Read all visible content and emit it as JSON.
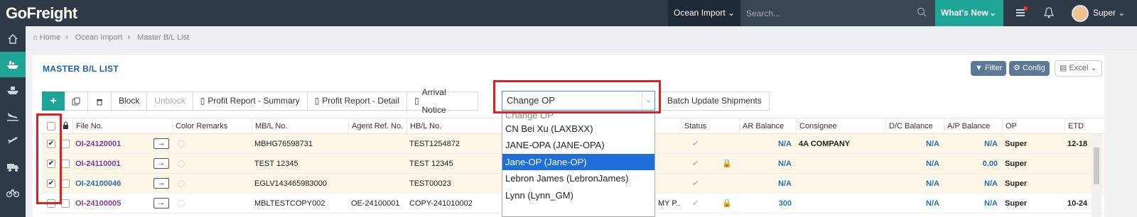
{
  "app": {
    "logo": "GoFreight"
  },
  "topbar": {
    "module": "Ocean Import",
    "search_placeholder": "Search...",
    "whats_new": "What's New",
    "user": "Super"
  },
  "breadcrumb": [
    "Home",
    "Ocean Import",
    "Master B/L List"
  ],
  "page": {
    "title": "MASTER B/L LIST",
    "filter": "Filter",
    "config": "Config",
    "excel": "Excel"
  },
  "toolbar": {
    "block": "Block",
    "unblock": "Unblock",
    "profit_summary": "Profit Report - Summary",
    "profit_detail": "Profit Report - Detail",
    "arrival_notice": "Arrival Notice",
    "change_op_value": "Change OP",
    "batch_update": "Batch Update Shipments"
  },
  "dropdown": {
    "options": [
      "Change OP",
      "CN Bei Xu (LAXBXX)",
      "JANE-OPA (JANE-OPA)",
      "Jane-OP (Jane-OP)",
      "Lebron James (LebronJames)",
      "Lynn (Lynn_GM)"
    ],
    "highlighted": "Jane-OP (Jane-OP)"
  },
  "columns": [
    "File No.",
    "Color Remarks",
    "MB/L No.",
    "Agent Ref. No.",
    "HB/L No.",
    "Status",
    "AR Balance",
    "Consignee",
    "D/C Balance",
    "A/P Balance",
    "OP",
    "ETD"
  ],
  "rows": [
    {
      "file": "OI-24120001",
      "mbl": "MBHG76598731",
      "agent": "",
      "hbl": "TEST1254872",
      "ar": "N/A",
      "consignee": "4A COMPANY",
      "dc": "N/A",
      "ap": "N/A",
      "op": "Super",
      "etd": "12-18",
      "checked": true,
      "lock": false,
      "ref": ""
    },
    {
      "file": "OI-24110001",
      "mbl": "TEST 12345",
      "agent": "",
      "hbl": "TEST 12345",
      "ar": "N/A",
      "consignee": "",
      "dc": "N/A",
      "ap": "0.00",
      "op": "Super",
      "etd": "",
      "checked": true,
      "lock": true,
      "ref": ""
    },
    {
      "file": "OI-24100046",
      "mbl": "EGLV143465983000",
      "agent": "",
      "hbl": "TEST00023",
      "ar": "N/A",
      "consignee": "",
      "dc": "N/A",
      "ap": "N/A",
      "op": "Super",
      "etd": "",
      "checked": true,
      "lock": false,
      "ref": ""
    },
    {
      "file": "OI-24100005",
      "mbl": "MBLTESTCOPY002",
      "agent": "OE-24100001",
      "hbl": "COPY-241010002",
      "ar": "300",
      "consignee": "",
      "dc": "N/A",
      "ap": "N/A",
      "op": "Super",
      "etd": "10-24",
      "checked": false,
      "lock": true,
      "ref": "MY P..."
    }
  ]
}
